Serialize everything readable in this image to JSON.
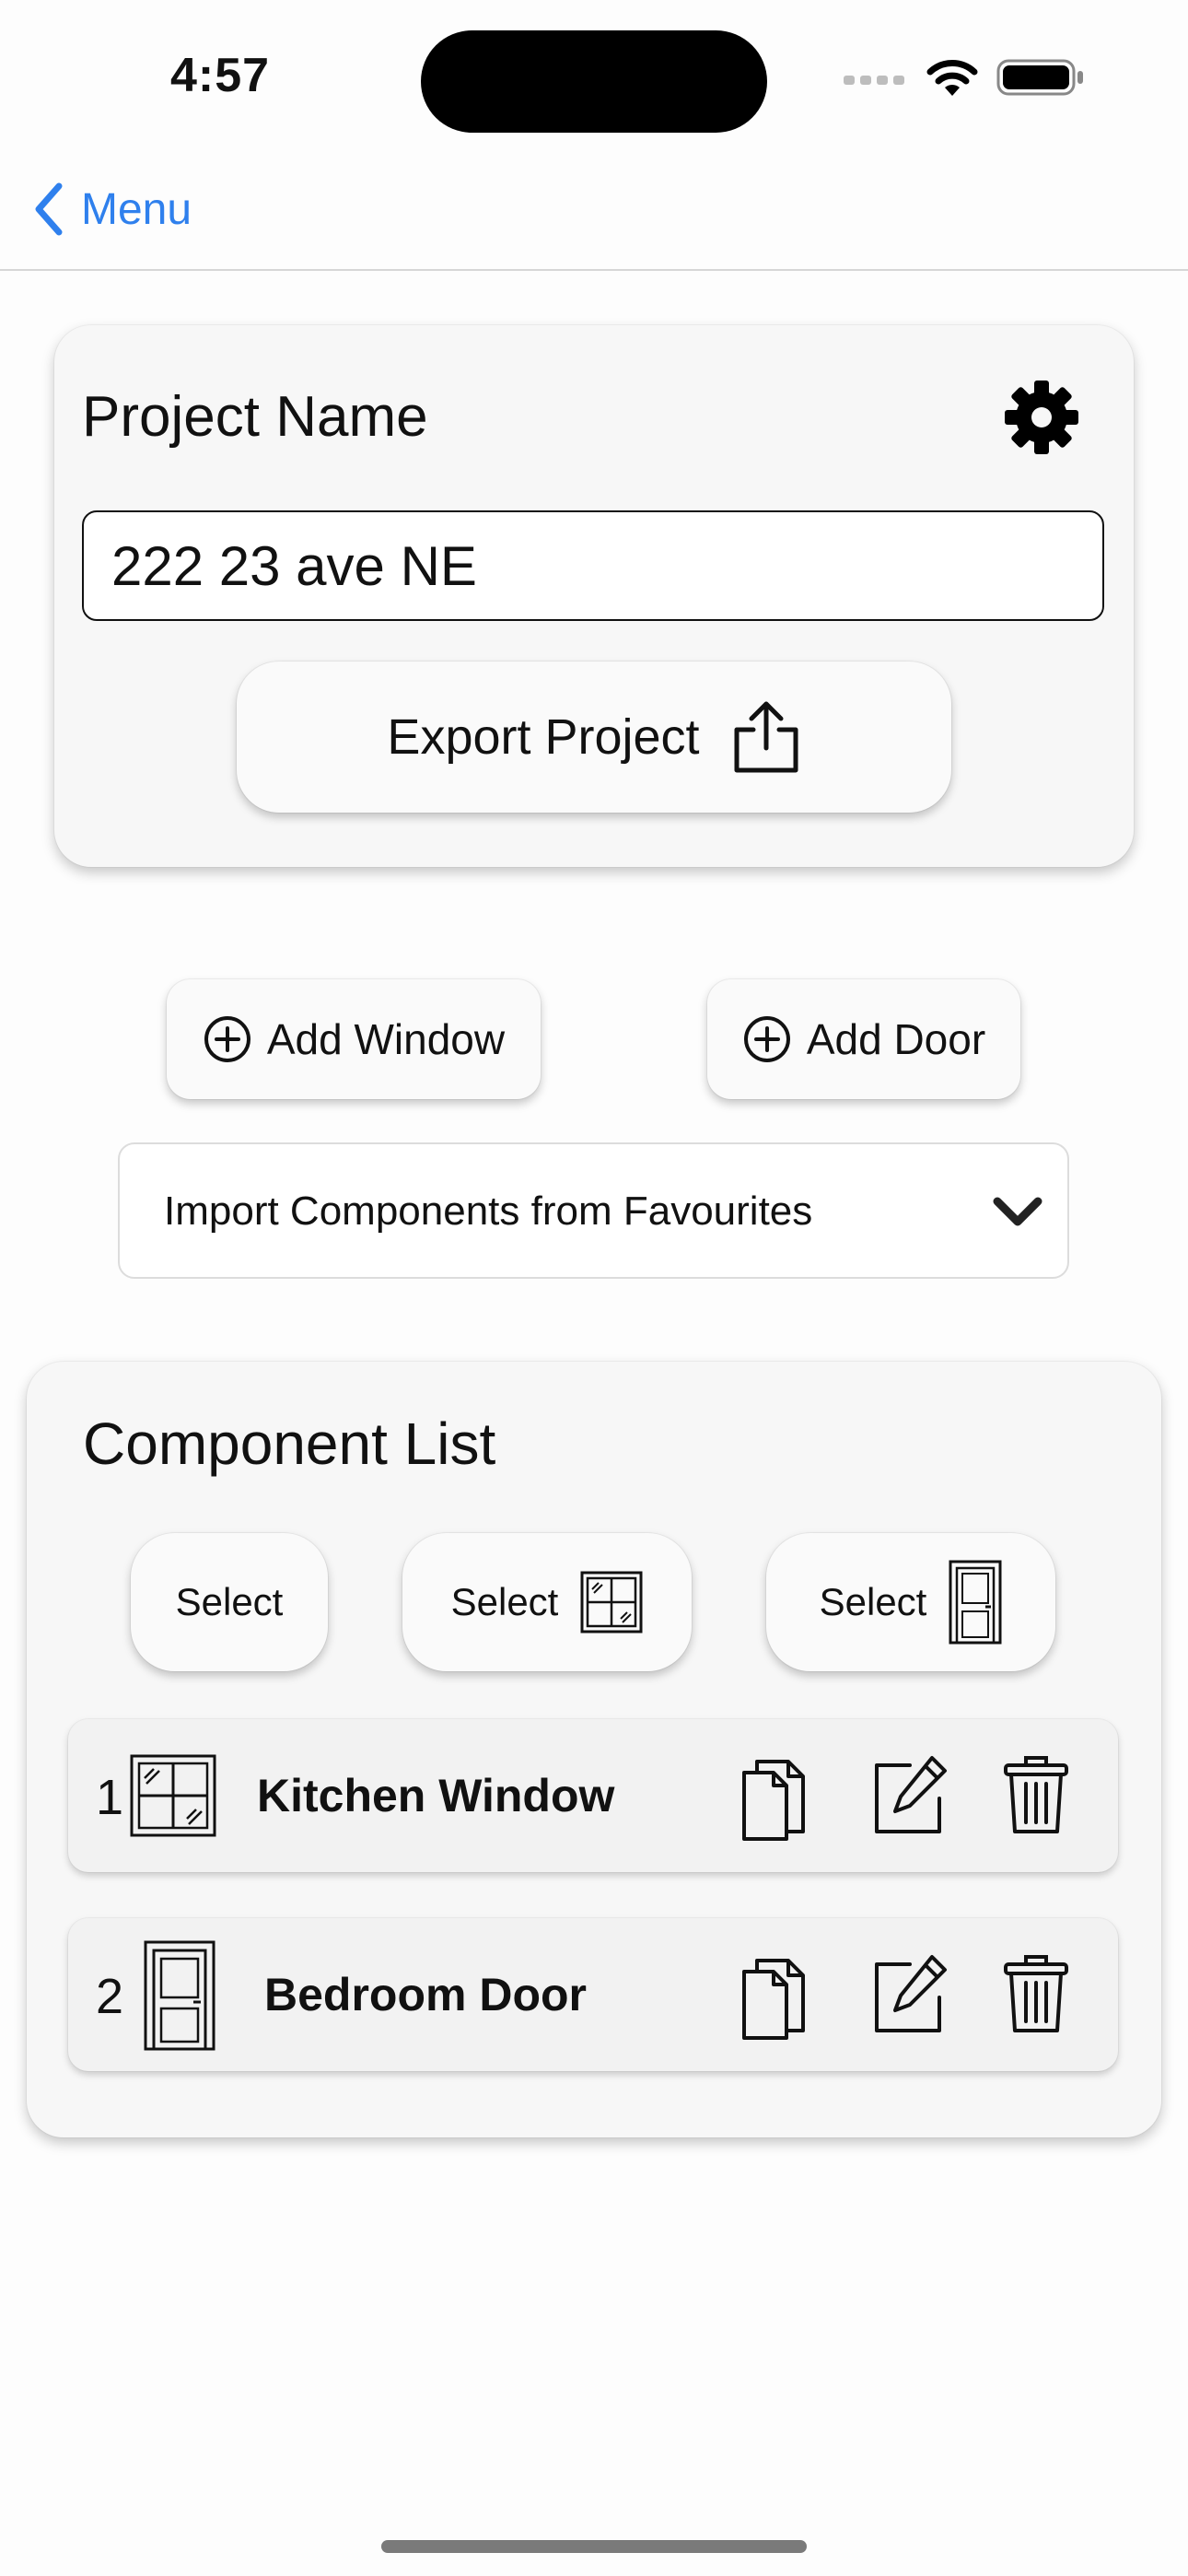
{
  "status_bar": {
    "time": "4:57",
    "icons": [
      "signal-icon",
      "wifi-icon",
      "battery-icon"
    ]
  },
  "nav": {
    "back_label": "Menu",
    "accent": "#2f80ed"
  },
  "project": {
    "title": "Project Name",
    "name_value": "222 23 ave NE",
    "export_label": "Export Project",
    "settings_icon": "gear-icon",
    "export_icon": "share-icon"
  },
  "actions": {
    "add_window_label": "Add Window",
    "add_door_label": "Add Door",
    "add_icon": "plus-circle-icon"
  },
  "import": {
    "label": "Import Components from Favourites",
    "icon": "chevron-down-icon"
  },
  "component_list": {
    "title": "Component List",
    "select_all_label": "Select",
    "select_window_label": "Select",
    "select_door_label": "Select",
    "items": [
      {
        "index": "1",
        "name": "Kitchen Window",
        "type": "window"
      },
      {
        "index": "2",
        "name": "Bedroom Door",
        "type": "door"
      }
    ],
    "row_actions": [
      "duplicate-icon",
      "edit-icon",
      "trash-icon"
    ]
  }
}
